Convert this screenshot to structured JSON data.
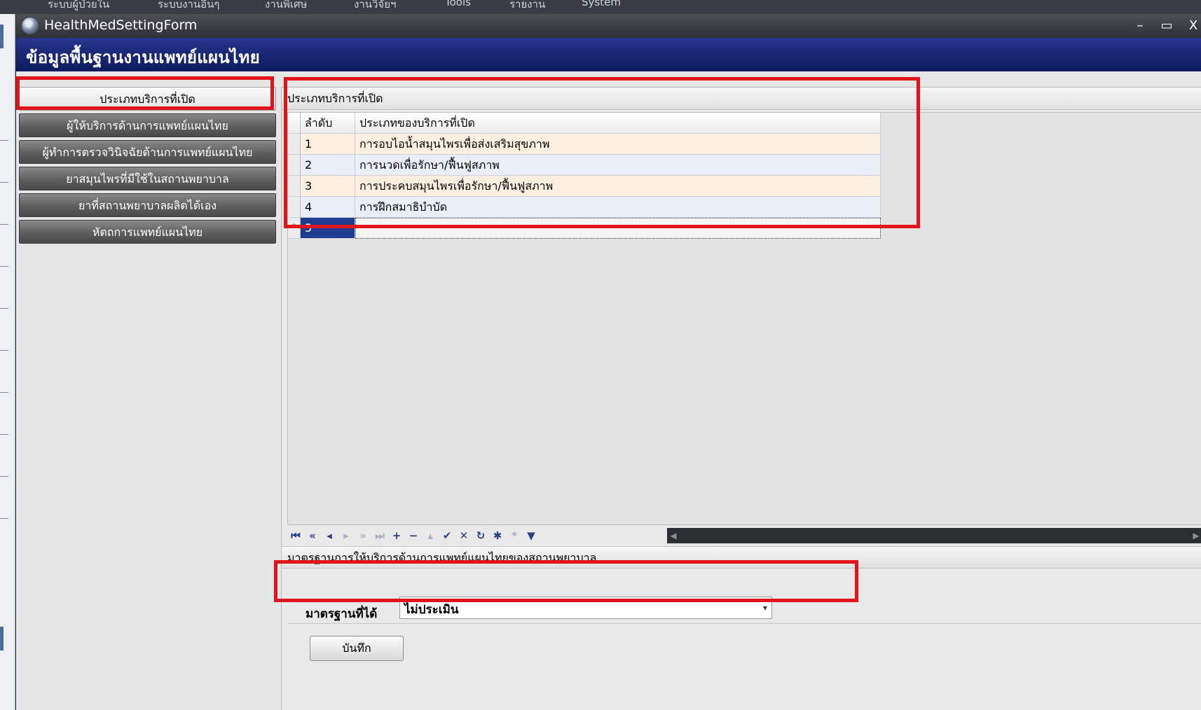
{
  "background_app": {
    "menu_items": [
      "ระบบผู้ป่วยใน",
      "ระบบงานอื่นๆ",
      "งานพิเศษ",
      "งานวิจัยฯ",
      "Tools",
      "รายงาน",
      "System"
    ]
  },
  "window": {
    "title": "HealthMedSettingForm",
    "minimize_icon": "minimize-icon",
    "maximize_icon": "maximize-icon",
    "close_icon": "close-icon",
    "minimize_glyph": "–",
    "maximize_glyph": "▭",
    "close_glyph": "X"
  },
  "header": {
    "title": "ข้อมูลพื้นฐานงานแพทย์แผนไทย"
  },
  "sidebar": {
    "items": [
      {
        "label": "ประเภทบริการที่เปิด",
        "active": true
      },
      {
        "label": "ผู้ให้บริการด้านการแพทย์แผนไทย",
        "active": false
      },
      {
        "label": "ผู้ทำการตรวจวินิจฉัยด้านการแพทย์แผนไทย",
        "active": false
      },
      {
        "label": "ยาสมุนไพรที่มีใช้ในสถานพยาบาล",
        "active": false
      },
      {
        "label": "ยาที่สถานพยาบาลผลิตได้เอง",
        "active": false
      },
      {
        "label": "หัตถการแพทย์แผนไทย",
        "active": false
      }
    ]
  },
  "service_types": {
    "group_title": "ประเภทบริการที่เปิด",
    "columns": [
      "ลำดับ",
      "ประเภทของบริการที่เปิด"
    ],
    "rows": [
      {
        "no": "1",
        "name": "การอบไอน้ำสมุนไพรเพื่อส่งเสริมสุขภาพ"
      },
      {
        "no": "2",
        "name": "การนวดเพื่อรักษา/ฟื้นฟูสภาพ"
      },
      {
        "no": "3",
        "name": "การประคบสมุนไพรเพื่อรักษา/ฟื้นฟูสภาพ"
      },
      {
        "no": "4",
        "name": "การฝึกสมาธิบำบัด"
      }
    ],
    "new_row": {
      "marker": "*",
      "no": "5",
      "name": ""
    }
  },
  "navigator": {
    "buttons": [
      {
        "name": "first-record-icon",
        "glyph": "⏮"
      },
      {
        "name": "prev-page-icon",
        "glyph": "«"
      },
      {
        "name": "prev-record-icon",
        "glyph": "◂"
      },
      {
        "name": "next-record-icon",
        "glyph": "▸"
      },
      {
        "name": "next-page-icon",
        "glyph": "»"
      },
      {
        "name": "last-record-icon",
        "glyph": "⏭"
      },
      {
        "name": "append-icon",
        "glyph": "+"
      },
      {
        "name": "delete-icon",
        "glyph": "−"
      },
      {
        "name": "edit-icon",
        "glyph": "▴"
      },
      {
        "name": "post-icon",
        "glyph": "✔"
      },
      {
        "name": "cancel-icon",
        "glyph": "✕"
      },
      {
        "name": "refresh-icon",
        "glyph": "↻"
      },
      {
        "name": "bookmark-icon",
        "glyph": "✱"
      },
      {
        "name": "goto-bookmark-icon",
        "glyph": "*"
      },
      {
        "name": "filter-icon",
        "glyph": "▼"
      }
    ]
  },
  "standard": {
    "group_title": "มาตรฐานการให้บริการด้านการแพทย์แผนไทยของสถานพยาบาล",
    "label": "มาตรฐานที่ได้",
    "selected": "ไม่ประเมิน",
    "dropdown_icon": "chevron-down-icon",
    "dropdown_glyph": "▾"
  },
  "actions": {
    "save_label": "บันทึก"
  },
  "colors": {
    "annotation_red": "#e0141a",
    "header_blue": "#1a2a78",
    "row_odd": "#fdf0e0",
    "row_even": "#e9eef8"
  }
}
